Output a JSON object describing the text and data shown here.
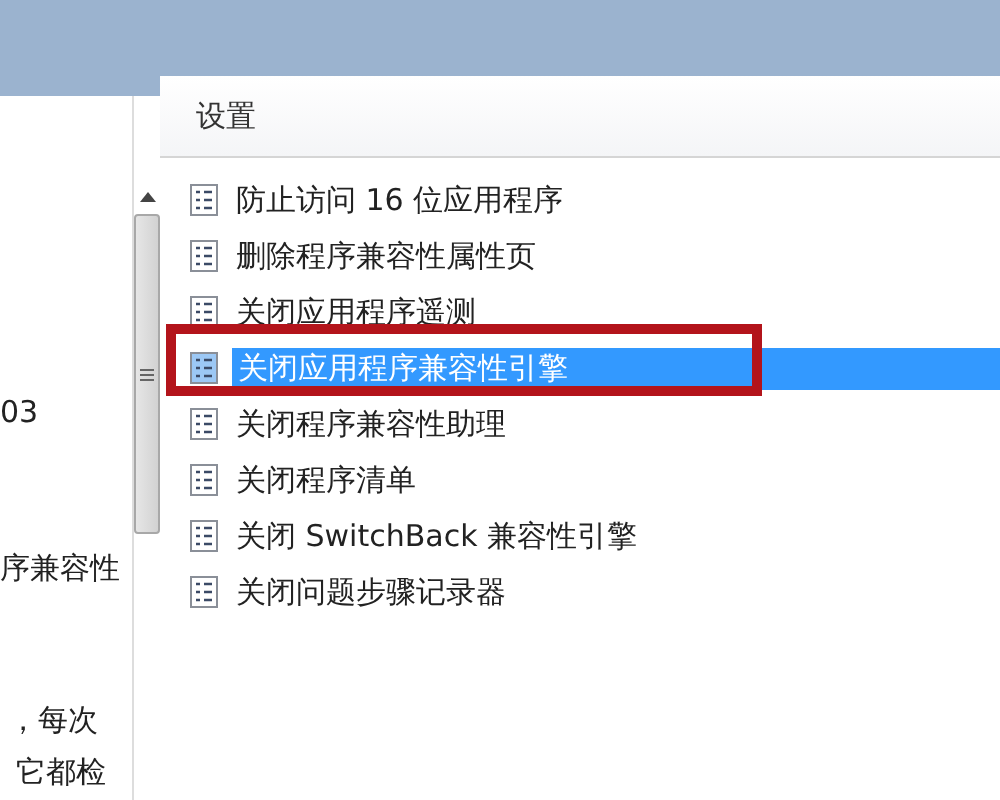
{
  "description_pane": {
    "lines": [
      "03",
      "序兼容性",
      "，每次",
      "它都检"
    ]
  },
  "settings_list": {
    "column_header": "设置",
    "items": [
      {
        "label": "防止访问 16 位应用程序",
        "selected": false,
        "highlighted": false
      },
      {
        "label": "删除程序兼容性属性页",
        "selected": false,
        "highlighted": false
      },
      {
        "label": "关闭应用程序遥测",
        "selected": false,
        "highlighted": false
      },
      {
        "label": "关闭应用程序兼容性引擎",
        "selected": true,
        "highlighted": true
      },
      {
        "label": "关闭程序兼容性助理",
        "selected": false,
        "highlighted": false
      },
      {
        "label": "关闭程序清单",
        "selected": false,
        "highlighted": false
      },
      {
        "label": "关闭 SwitchBack 兼容性引擎",
        "selected": false,
        "highlighted": false
      },
      {
        "label": "关闭问题步骤记录器",
        "selected": false,
        "highlighted": false
      }
    ]
  }
}
